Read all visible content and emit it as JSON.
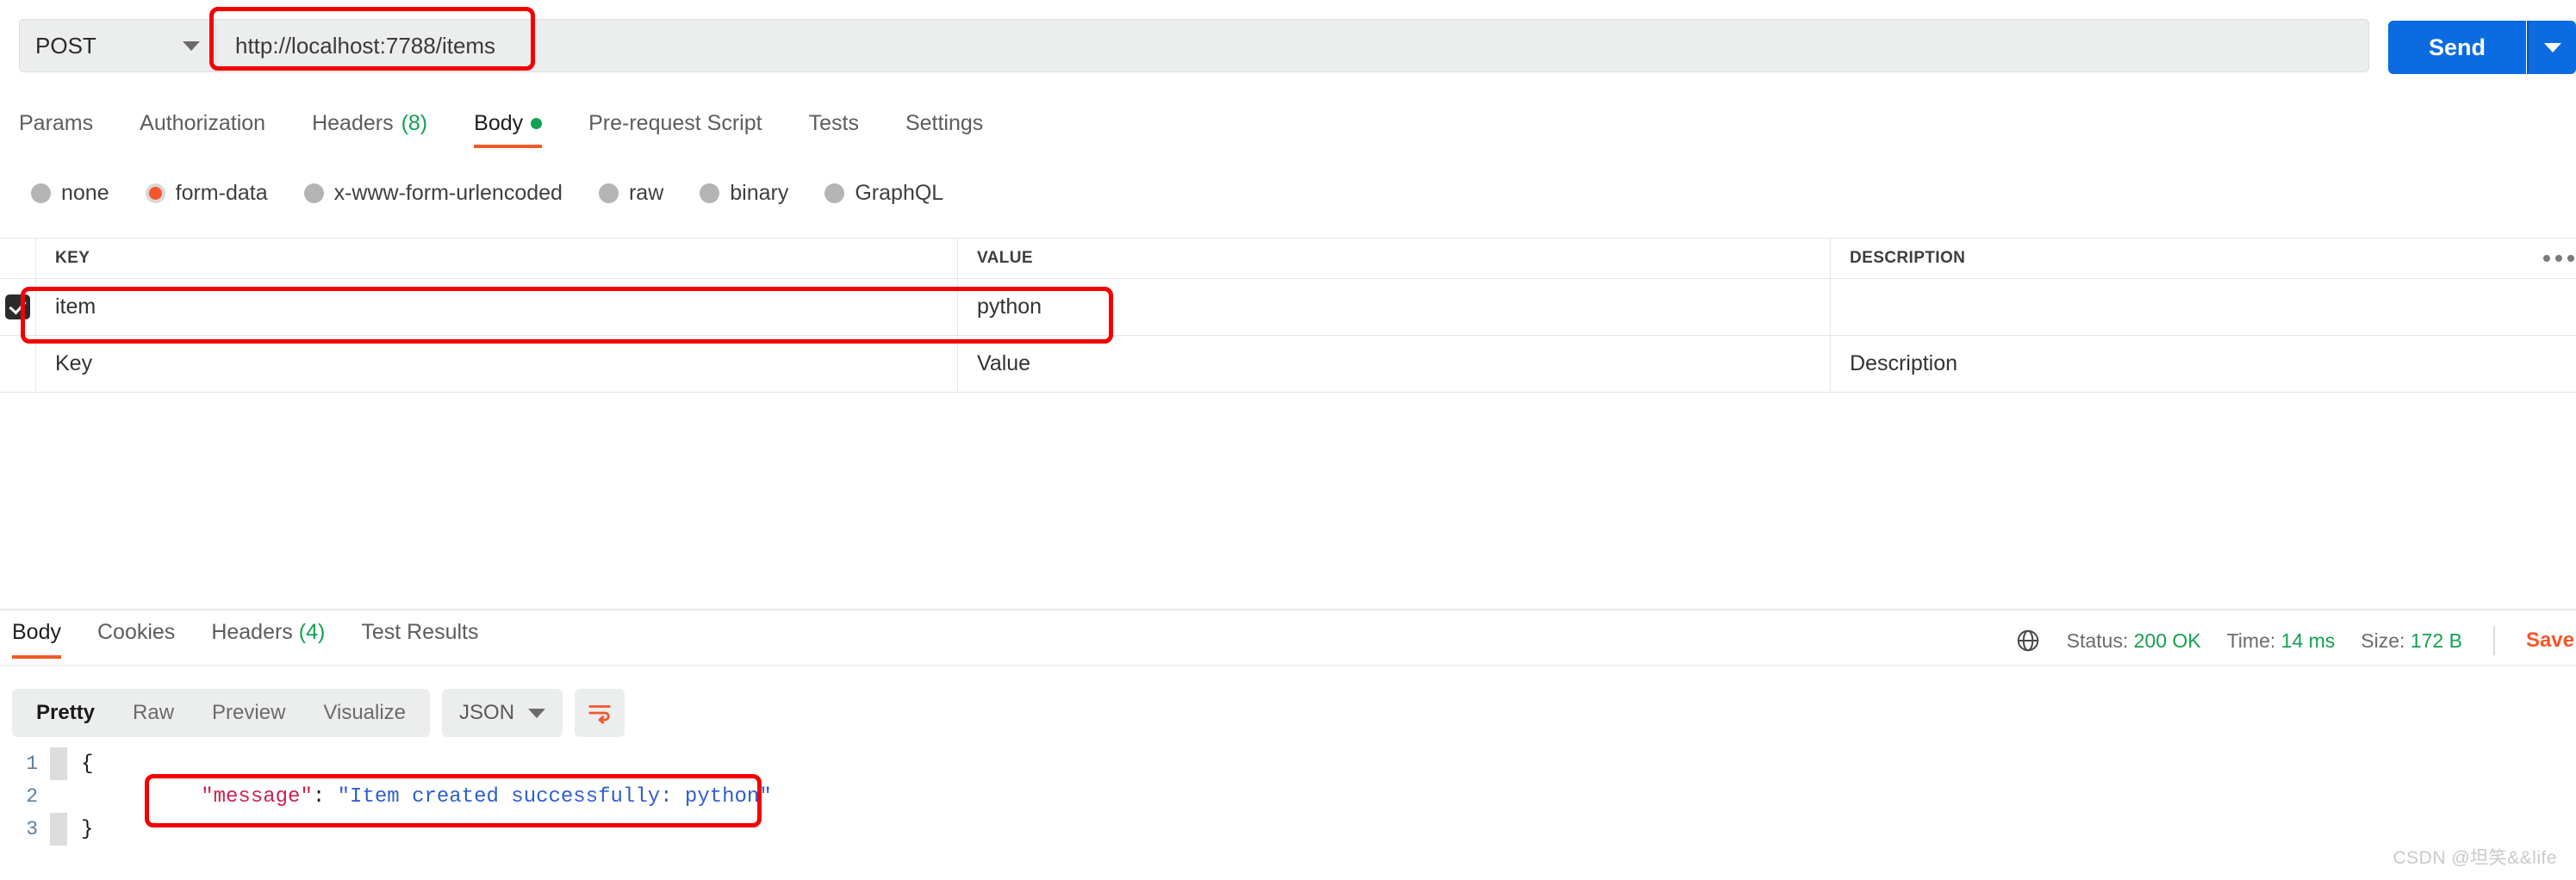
{
  "urlbar": {
    "method": "POST",
    "method_caret_icon": "chevron-down-icon",
    "url_value": "http://localhost:7788/items",
    "url_placeholder": "Enter request URL",
    "send_label": "Send",
    "send_caret_icon": "chevron-down-icon"
  },
  "request_tabs": [
    {
      "label": "Params",
      "count": "",
      "dot": false,
      "active": false
    },
    {
      "label": "Authorization",
      "count": "",
      "dot": false,
      "active": false
    },
    {
      "label": "Headers",
      "count": "(8)",
      "dot": false,
      "active": false
    },
    {
      "label": "Body",
      "count": "",
      "dot": true,
      "active": true
    },
    {
      "label": "Pre-request Script",
      "count": "",
      "dot": false,
      "active": false
    },
    {
      "label": "Tests",
      "count": "",
      "dot": false,
      "active": false
    },
    {
      "label": "Settings",
      "count": "",
      "dot": false,
      "active": false
    }
  ],
  "body_types": [
    {
      "label": "none",
      "checked": false
    },
    {
      "label": "form-data",
      "checked": true
    },
    {
      "label": "x-www-form-urlencoded",
      "checked": false
    },
    {
      "label": "raw",
      "checked": false
    },
    {
      "label": "binary",
      "checked": false
    },
    {
      "label": "GraphQL",
      "checked": false
    }
  ],
  "kv_table": {
    "headers": {
      "key": "KEY",
      "value": "VALUE",
      "description": "DESCRIPTION"
    },
    "more_icon": "ellipsis-icon",
    "rows": [
      {
        "checked": true,
        "key": "item",
        "value": "python",
        "description": ""
      }
    ],
    "placeholder_row": {
      "key": "Key",
      "value": "Value",
      "description": "Description"
    }
  },
  "response_tabs": [
    {
      "label": "Body",
      "count": "",
      "active": true
    },
    {
      "label": "Cookies",
      "count": "",
      "active": false
    },
    {
      "label": "Headers",
      "count": "(4)",
      "active": false
    },
    {
      "label": "Test Results",
      "count": "",
      "active": false
    }
  ],
  "response_meta": {
    "globe_icon": "globe-icon",
    "status_label": "Status:",
    "status_value": "200 OK",
    "time_label": "Time:",
    "time_value": "14 ms",
    "size_label": "Size:",
    "size_value": "172 B",
    "save_label": "Save"
  },
  "format_bar": {
    "views": [
      {
        "label": "Pretty",
        "active": true
      },
      {
        "label": "Raw",
        "active": false
      },
      {
        "label": "Preview",
        "active": false
      },
      {
        "label": "Visualize",
        "active": false
      }
    ],
    "language": "JSON",
    "language_caret_icon": "chevron-down-icon",
    "wrap_icon": "word-wrap-icon"
  },
  "json_body": {
    "lines": [
      {
        "num": "1",
        "open_brace": "{"
      },
      {
        "num": "2",
        "key": "\"message\"",
        "colon": ": ",
        "value": "\"Item created successfully: python\""
      },
      {
        "num": "3",
        "close_brace": "}"
      }
    ]
  },
  "watermark": "CSDN @坦笑&&life",
  "colors": {
    "accent_orange": "#ef5b25",
    "send_blue": "#0b6be0",
    "success_green": "#12a150",
    "annotation_red": "#f50000",
    "json_key": "#c7254e",
    "json_string": "#2f5fcf"
  }
}
